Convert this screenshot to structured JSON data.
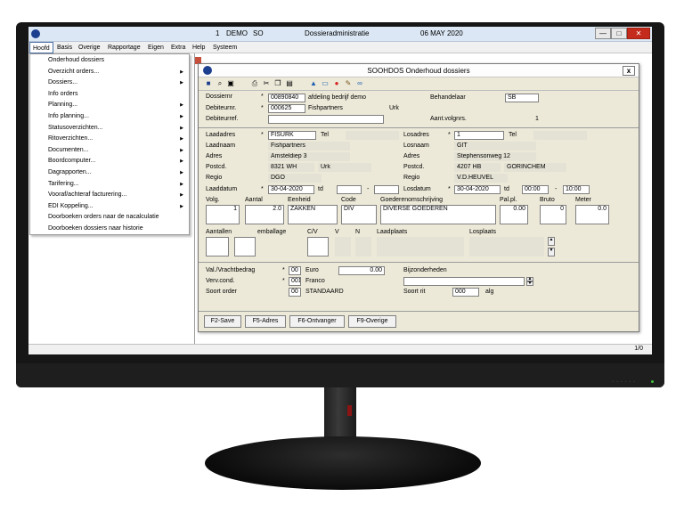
{
  "titlebar": {
    "num": "1",
    "env": "DEMO",
    "code": "SO",
    "app": "Dossieradministratie",
    "date": "06 MAY 2020",
    "min": "—",
    "max": "□",
    "close": "✕"
  },
  "menubar": [
    "Hoofd",
    "Basis",
    "Overige",
    "Rapportage",
    "Eigen",
    "Extra",
    "Help",
    "Systeem"
  ],
  "dropdown": [
    {
      "label": "Onderhoud dossiers",
      "sub": false
    },
    {
      "label": "Overzicht orders...",
      "sub": true
    },
    {
      "label": "Dossiers...",
      "sub": true
    },
    {
      "label": "Info orders",
      "sub": false
    },
    {
      "label": "Planning...",
      "sub": true
    },
    {
      "label": "Info planning...",
      "sub": true
    },
    {
      "label": "Statusoverzichten...",
      "sub": true
    },
    {
      "label": "Ritoverzichten...",
      "sub": true
    },
    {
      "label": "Documenten...",
      "sub": true
    },
    {
      "label": "Boordcomputer...",
      "sub": true
    },
    {
      "label": "Dagrapporten...",
      "sub": true
    },
    {
      "label": "Tarifering...",
      "sub": true
    },
    {
      "label": "Vooraf/achteraf facturering...",
      "sub": true
    },
    {
      "label": "EDI Koppeling...",
      "sub": true
    },
    {
      "label": "Doorboeken orders naar de nacalculatie",
      "sub": false
    },
    {
      "label": "Doorboeken dossiers naar historie",
      "sub": false
    }
  ],
  "status": {
    "page": "1/0"
  },
  "form": {
    "title": "SOOHDOS Onderhoud dossiers",
    "close": "x",
    "dossiernr_label": "Dossiernr",
    "dossiernr": "00890840",
    "dossier_desc": "afdeling bedrijf demo",
    "behandelaar_label": "Behandelaar",
    "behandelaar": "SB",
    "debiteurnr_label": "Debiteurnr.",
    "debiteurnr": "000625",
    "debiteur_naam": "Fishpartners",
    "debiteur_plaats": "Urk",
    "debiteurref_label": "Debiteurref.",
    "aantvolgnrs_label": "Aant.volgnrs.",
    "aantvolgnrs": "1",
    "laadadres_label": "Laadadres",
    "laadadres": "FISURK",
    "tel_label": "Tel",
    "losadres_label": "Losadres",
    "losadres": "1",
    "laadnaam_label": "Laadnaam",
    "laadnaam": "Fishpartners",
    "losnaam_label": "Losnaam",
    "losnaam": "GIT",
    "adres_label": "Adres",
    "laad_adres": "Amsteldiep 3",
    "los_adres": "Stephensonweg 12",
    "postcd_label": "Postcd.",
    "laad_postcd": "8321 WH",
    "laad_plaats": "Urk",
    "los_postcd": "4207 HB",
    "los_plaats": "GORINCHEM",
    "regio_label": "Regio",
    "laad_regio": "DGO",
    "los_regio": "V.D.HEUVEL",
    "laaddatum_label": "Laaddatum",
    "laaddatum": "30-04-2020",
    "td_label": "td",
    "dash": "-",
    "losdatum_label": "Losdatum",
    "losdatum": "30-04-2020",
    "los_tijd_van": "00:00",
    "los_tijd_tot": "10:00",
    "col_volg": "Volg.",
    "col_aantal": "Aantal",
    "col_eenheid": "Eenheid",
    "col_code": "Code",
    "col_goederen": "Goederenomschrijving",
    "col_palpl": "Pal.pl.",
    "col_bruto": "Bruto",
    "col_meter": "Meter",
    "row_volg": "1",
    "row_aantal": "2.0",
    "row_eenheid": "ZAKKEN",
    "row_code": "DIV",
    "row_goederen": "DIVERSE GOEDEREN",
    "row_palpl": "0.00",
    "row_bruto": "0",
    "row_meter": "0.0",
    "aantallen_label": "Aantallen",
    "emballage_label": "emballage",
    "cv_label": "C/V",
    "v_label": "V",
    "n_label": "N",
    "laadplaats_label": "Laadplaats",
    "losplaats_label": "Losplaats",
    "val_label": "Val./Vrachtbedrag",
    "val_code": "00",
    "val_naam": "Euro",
    "vrachtbedrag": "0.00",
    "bijzonderheden_label": "Bijzonderheden",
    "verv_label": "Verv.cond.",
    "verv_code": "001",
    "verv_naam": "Franco",
    "soortorder_label": "Soort order",
    "soortorder_code": "00",
    "soortorder_naam": "STANDAARD",
    "soortrit_label": "Soort rit",
    "soortrit": "000",
    "soortrit_naam": "alg",
    "btn_save": "F2-Save",
    "btn_adres": "F5-Adres",
    "btn_ontvanger": "F6-Ontvanger",
    "btn_overige": "F9-Overige"
  }
}
